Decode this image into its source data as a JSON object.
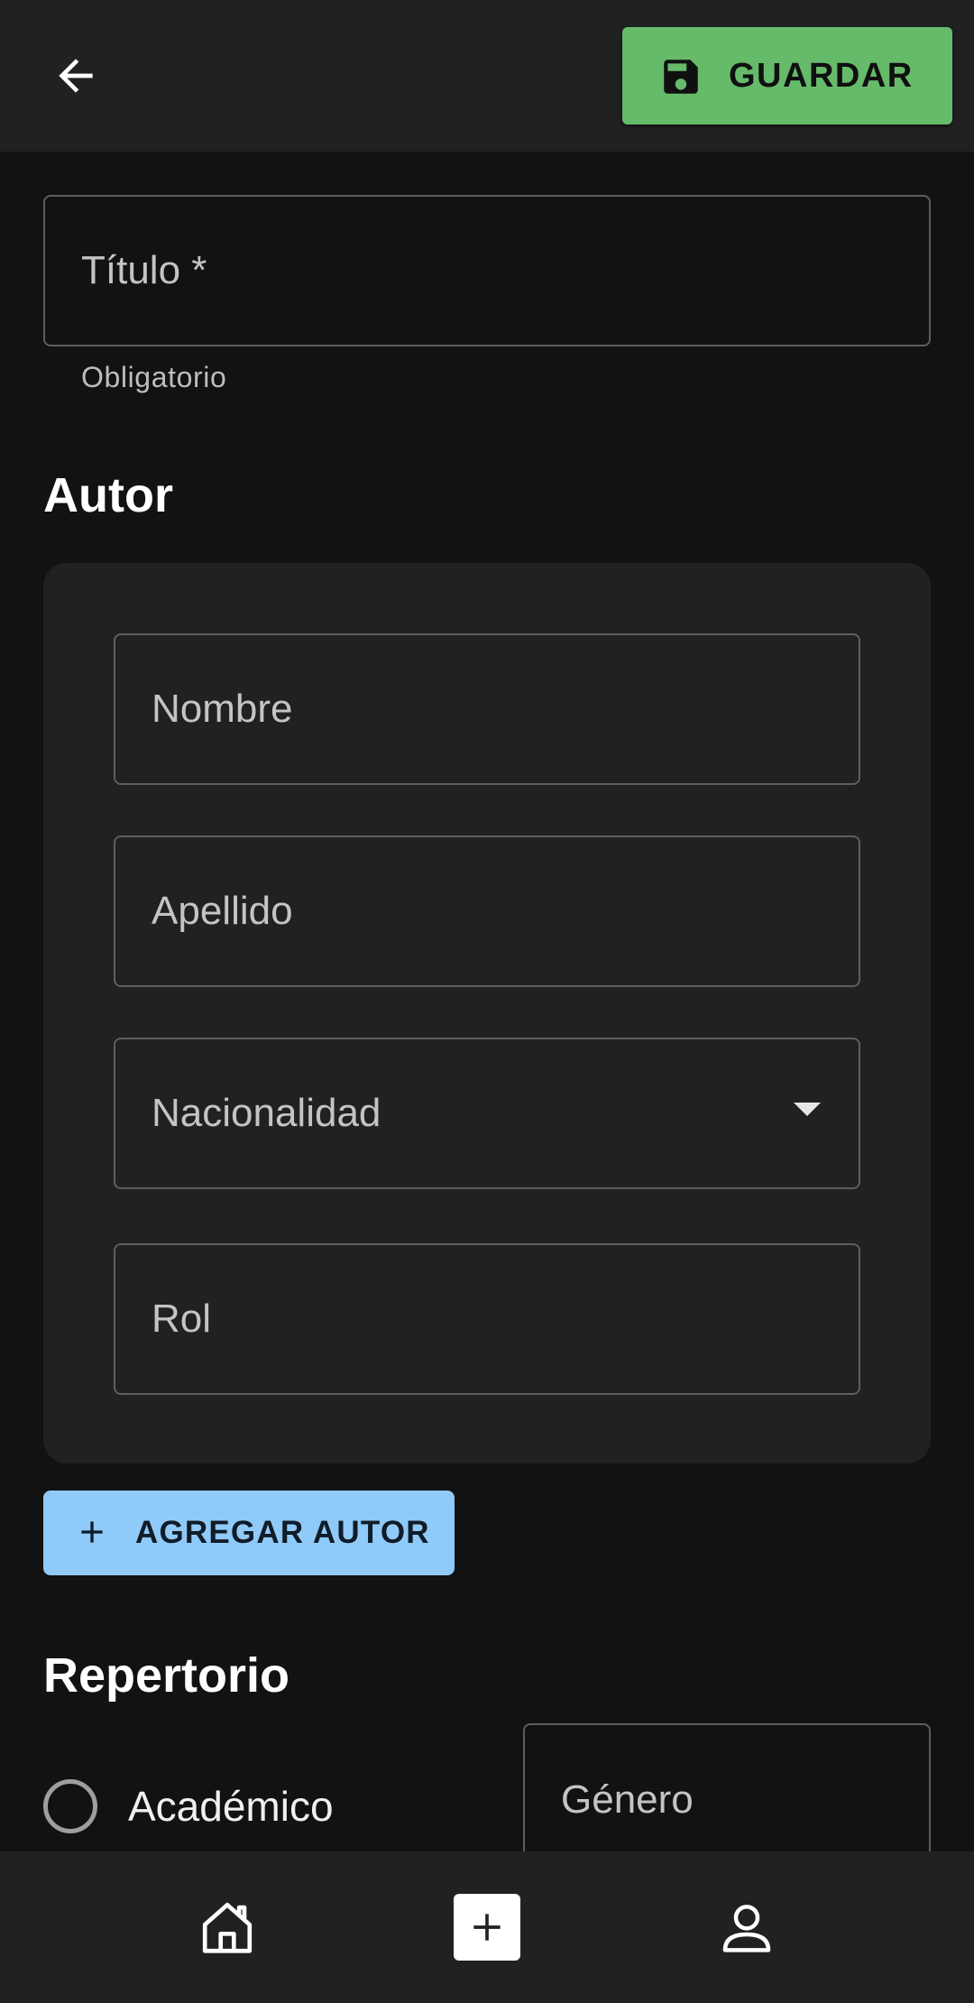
{
  "header": {
    "back_icon": "arrow-back-icon",
    "save_icon": "floppy-disk-icon",
    "save_label": "GUARDAR",
    "save_color": "#66bb6a"
  },
  "form": {
    "title_field": {
      "placeholder": "Título *",
      "value": "",
      "helper": "Obligatorio"
    },
    "author_section": {
      "heading": "Autor",
      "fields": {
        "first_name": "Nombre",
        "last_name": "Apellido",
        "nationality": "Nacionalidad",
        "role": "Rol"
      },
      "add_button": {
        "icon": "plus-icon",
        "label": "AGREGAR AUTOR",
        "color": "#90caf9"
      }
    },
    "repertoire_section": {
      "heading": "Repertorio",
      "radio_option": "Académico",
      "genre_placeholder": "Género"
    }
  },
  "bottom_nav": {
    "items": [
      {
        "icon": "home-icon"
      },
      {
        "icon": "add-box-icon"
      },
      {
        "icon": "person-icon"
      }
    ]
  },
  "theme": {
    "background": "#121212",
    "surface": "#212121"
  }
}
